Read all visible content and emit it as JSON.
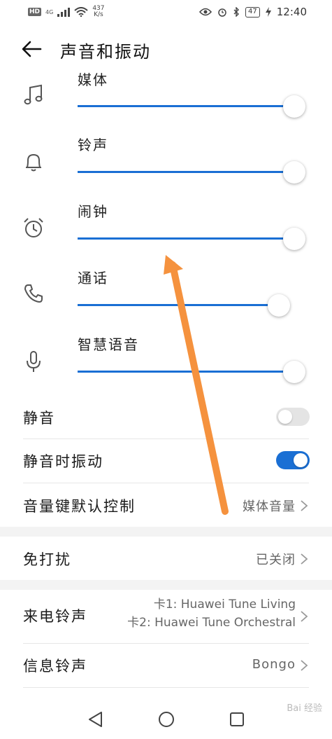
{
  "status_bar": {
    "hd": "HD",
    "network": "4G",
    "speed_value": "437",
    "speed_unit": "K/s",
    "battery": "47",
    "time": "12:40"
  },
  "header": {
    "title": "声音和振动"
  },
  "volumes": [
    {
      "label": "媒体",
      "icon": "music-note-icon",
      "level": 0.97
    },
    {
      "label": "铃声",
      "icon": "bell-icon",
      "level": 0.97
    },
    {
      "label": "闹钟",
      "icon": "alarm-clock-icon",
      "level": 0.97
    },
    {
      "label": "通话",
      "icon": "phone-icon",
      "level": 0.9
    },
    {
      "label": "智慧语音",
      "icon": "microphone-icon",
      "level": 0.97
    }
  ],
  "settings": {
    "mute": {
      "label": "静音",
      "on": false
    },
    "vibrate_on_mute": {
      "label": "静音时振动",
      "on": true
    },
    "volume_key": {
      "label": "音量键默认控制",
      "value": "媒体音量"
    },
    "dnd": {
      "label": "免打扰",
      "value": "已关闭"
    },
    "ringtone": {
      "label": "来电铃声",
      "sim1": "卡1: Huawei Tune Living",
      "sim2": "卡2: Huawei Tune Orchestral"
    },
    "message_tone": {
      "label": "信息铃声",
      "value": "Bongo"
    }
  },
  "watermark": "Bai 经验",
  "colors": {
    "accent": "#1a6fd4",
    "arrow": "#f5923e"
  }
}
